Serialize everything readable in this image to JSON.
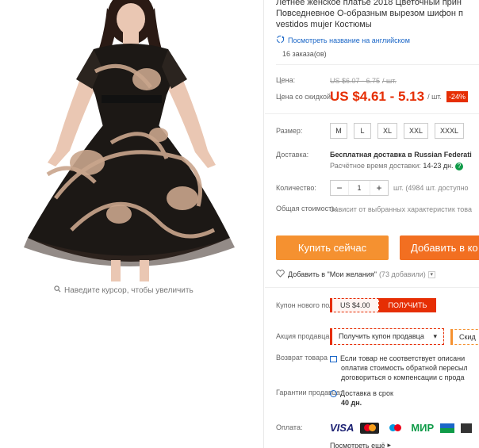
{
  "product": {
    "title_line1": "Летнее женское платье 2018 Цветочный прин",
    "title_line2": "Повседневное О-образным вырезом шифон п",
    "title_line3": "vestidos mujer Костюмы",
    "translate_link": "Посмотреть название на английском",
    "orders": "16 заказа(ов)",
    "zoom_hint": "Наведите курсор, чтобы увеличить"
  },
  "price": {
    "label": "Цена:",
    "old": "US $6.07 - 6.75",
    "old_unit": "/ шт.",
    "discount_label": "Цена со скидкой:",
    "new": "US $4.61 - 5.13",
    "unit": "/ шт.",
    "discount_badge": "-24%"
  },
  "size": {
    "label": "Размер:",
    "options": [
      "M",
      "L",
      "XL",
      "XXL",
      "XXXL"
    ]
  },
  "shipping": {
    "label": "Доставка:",
    "title": "Бесплатная доставка в Russian Federati",
    "estimate_label": "Расчётное время доставки:",
    "estimate_value": "14-23 дн."
  },
  "quantity": {
    "label": "Количество:",
    "minus": "−",
    "value": "1",
    "plus": "+",
    "stock": "шт. (4984 шт. доступно"
  },
  "total": {
    "label": "Общая стоимость:",
    "value": "Зависит от выбранных характеристик това"
  },
  "actions": {
    "buy_now": "Купить сейчас",
    "add_to_cart": "Добавить в ко",
    "wishlist": "Добавить в \"Мои желания\"",
    "wishlist_count": "(73 добавили)"
  },
  "coupons": {
    "new_user_label": "Купон нового пользователя :",
    "new_user_amount": "US $4.00",
    "new_user_button": "ПОЛУЧИТЬ",
    "seller_label": "Акция продавца:",
    "seller_coupon": "Получить купон продавца",
    "seller_discount": "Скид"
  },
  "returns": {
    "label": "Возврат товара",
    "line1": "Если товар не соответствует описани",
    "line2": "оплатив стоимость обратной пересыл",
    "line3": "договориться о компенсации с прода"
  },
  "guarantee": {
    "label": "Гарантии продавца:",
    "line1": "Доставка в срок",
    "line2": "40 дн."
  },
  "payment": {
    "label": "Оплата:",
    "logos": [
      "VISA",
      "mastercard",
      "Maestro",
      "МИР"
    ],
    "more": "Посмотреть ещё"
  },
  "colors": {
    "accent": "#e62e04",
    "buy": "#f59130",
    "cart": "#f26f21",
    "link": "#1a66c7"
  }
}
